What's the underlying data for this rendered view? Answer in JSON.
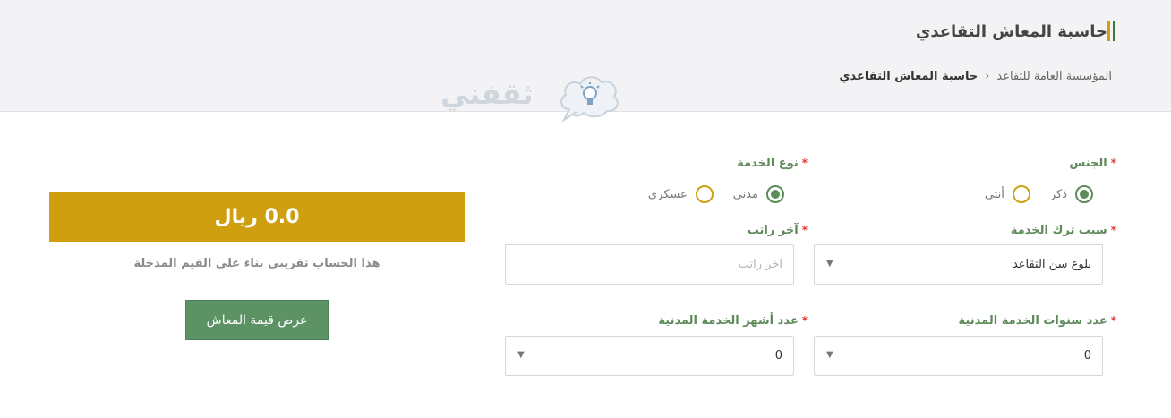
{
  "header": {
    "title": "حاسبة المعاش التقاعدي",
    "breadcrumb": {
      "home": "المؤسسة العامة للتقاعد",
      "separator": "‹",
      "current": "حاسبة المعاش التقاعدي"
    },
    "accent_colors": {
      "bar_green": "#3f7a3c",
      "bar_gold": "#cfa10f"
    }
  },
  "watermark": {
    "text": "ثقفني",
    "icon": "lightbulb-cloud-icon"
  },
  "form": {
    "gender": {
      "label": "الجنس",
      "options": [
        "ذكر",
        "أنثى"
      ],
      "selected": "ذكر"
    },
    "service_type": {
      "label": "نوع الخدمة",
      "options": [
        "مدني",
        "عسكري"
      ],
      "selected": "مدني"
    },
    "leave_reason": {
      "label": "سبب ترك الخدمة",
      "value": "بلوغ سن التقاعد"
    },
    "last_salary": {
      "label": "آخر راتب",
      "placeholder": "آخر راتب",
      "value": ""
    },
    "service_years": {
      "label": "عدد سنوات الخدمة المدنية",
      "value": "0"
    },
    "service_months": {
      "label": "عدد أشهر الخدمة المدنية",
      "value": "0"
    },
    "required_mark": "*"
  },
  "result": {
    "amount_text": "0.0 ريال",
    "note": "هذا الحساب تقريبي بناء على القيم المدخلة",
    "button_label": "عرض قيمة المعاش",
    "colors": {
      "result_bg": "#cf9f10",
      "button_bg": "#5c9264",
      "label": "#5e8a5a",
      "required": "#e53935"
    }
  }
}
